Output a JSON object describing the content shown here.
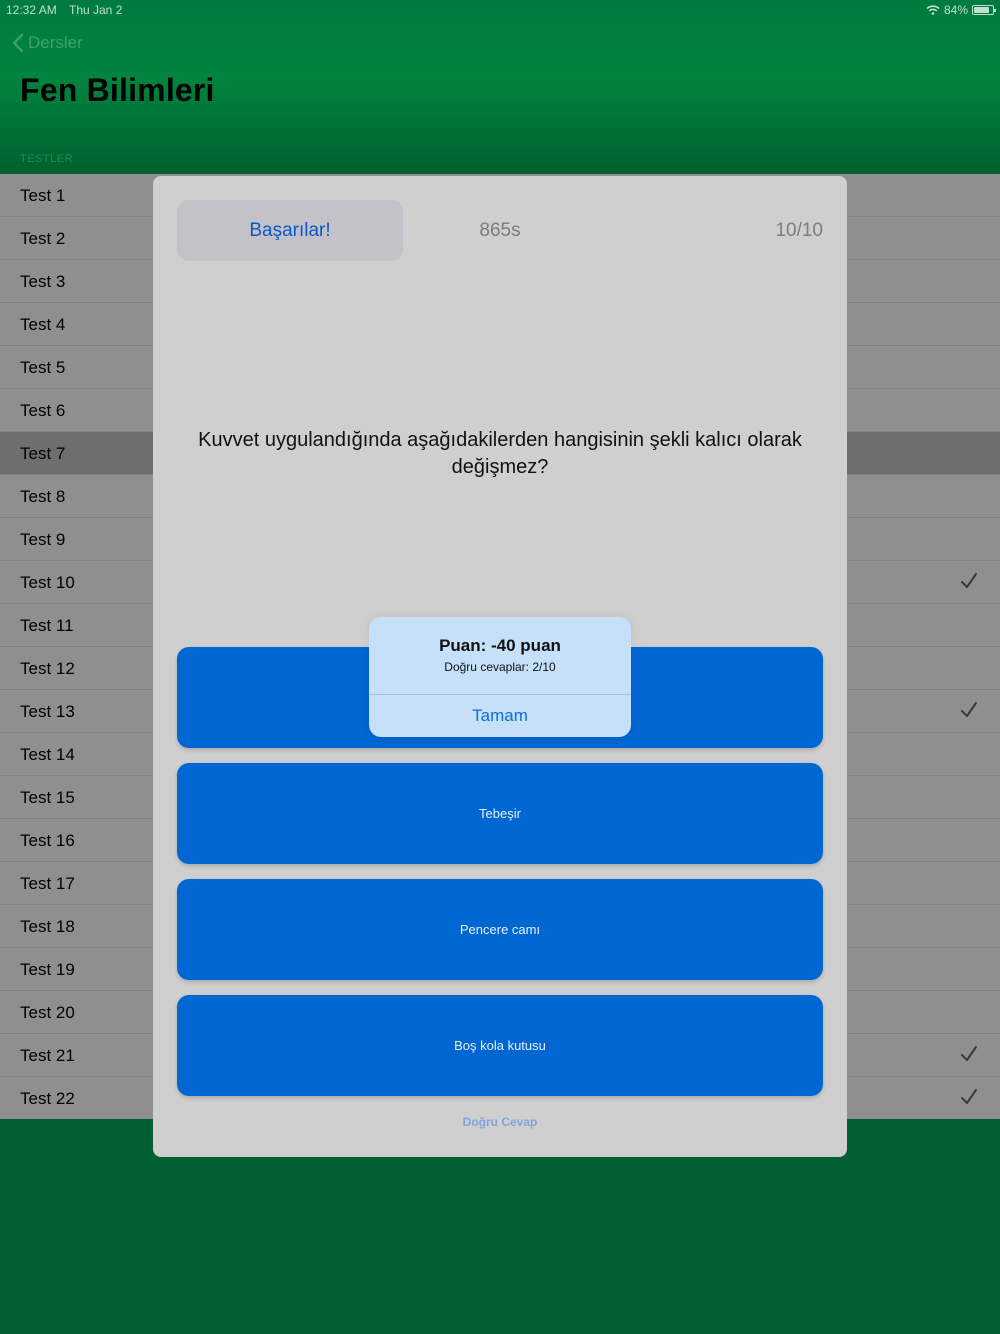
{
  "status_bar": {
    "time": "12:32 AM",
    "date": "Thu Jan 2",
    "battery": "84%",
    "battery_level": 0.84
  },
  "nav": {
    "back_label": "Dersler",
    "title": "Fen Bilimleri"
  },
  "section_header": "TESTLER",
  "tests": [
    {
      "label": "Test 1",
      "checked": false,
      "selected": false
    },
    {
      "label": "Test 2",
      "checked": false,
      "selected": false
    },
    {
      "label": "Test 3",
      "checked": false,
      "selected": false
    },
    {
      "label": "Test 4",
      "checked": false,
      "selected": false
    },
    {
      "label": "Test 5",
      "checked": false,
      "selected": false
    },
    {
      "label": "Test 6",
      "checked": false,
      "selected": false
    },
    {
      "label": "Test 7",
      "checked": false,
      "selected": true
    },
    {
      "label": "Test 8",
      "checked": false,
      "selected": false
    },
    {
      "label": "Test 9",
      "checked": false,
      "selected": false
    },
    {
      "label": "Test 10",
      "checked": true,
      "selected": false
    },
    {
      "label": "Test 11",
      "checked": false,
      "selected": false
    },
    {
      "label": "Test 12",
      "checked": false,
      "selected": false
    },
    {
      "label": "Test 13",
      "checked": true,
      "selected": false
    },
    {
      "label": "Test 14",
      "checked": false,
      "selected": false
    },
    {
      "label": "Test 15",
      "checked": false,
      "selected": false
    },
    {
      "label": "Test 16",
      "checked": false,
      "selected": false
    },
    {
      "label": "Test 17",
      "checked": false,
      "selected": false
    },
    {
      "label": "Test 18",
      "checked": false,
      "selected": false
    },
    {
      "label": "Test 19",
      "checked": false,
      "selected": false
    },
    {
      "label": "Test 20",
      "checked": false,
      "selected": false
    },
    {
      "label": "Test 21",
      "checked": true,
      "selected": false
    },
    {
      "label": "Test 22",
      "checked": true,
      "selected": false
    }
  ],
  "quiz": {
    "praise_label": "Başarılar!",
    "timer": "865s",
    "progress": "10/10",
    "question": "Kuvvet uygulandığında aşağıdakilerden hangisinin şekli kalıcı olarak değişmez?",
    "answers": [
      "",
      "Tebeşir",
      "Pencere camı",
      "Boş kola kutusu"
    ],
    "correct_answer_label": "Doğru Cevap"
  },
  "alert": {
    "title": "Puan: -40 puan",
    "message": "Doğru cevaplar: 2/10",
    "button_label": "Tamam"
  },
  "colors": {
    "header_green": "#007a3f",
    "answer_blue": "#0066d1",
    "alert_bg": "#c6e0fa",
    "link_blue": "#0a6fe0"
  }
}
